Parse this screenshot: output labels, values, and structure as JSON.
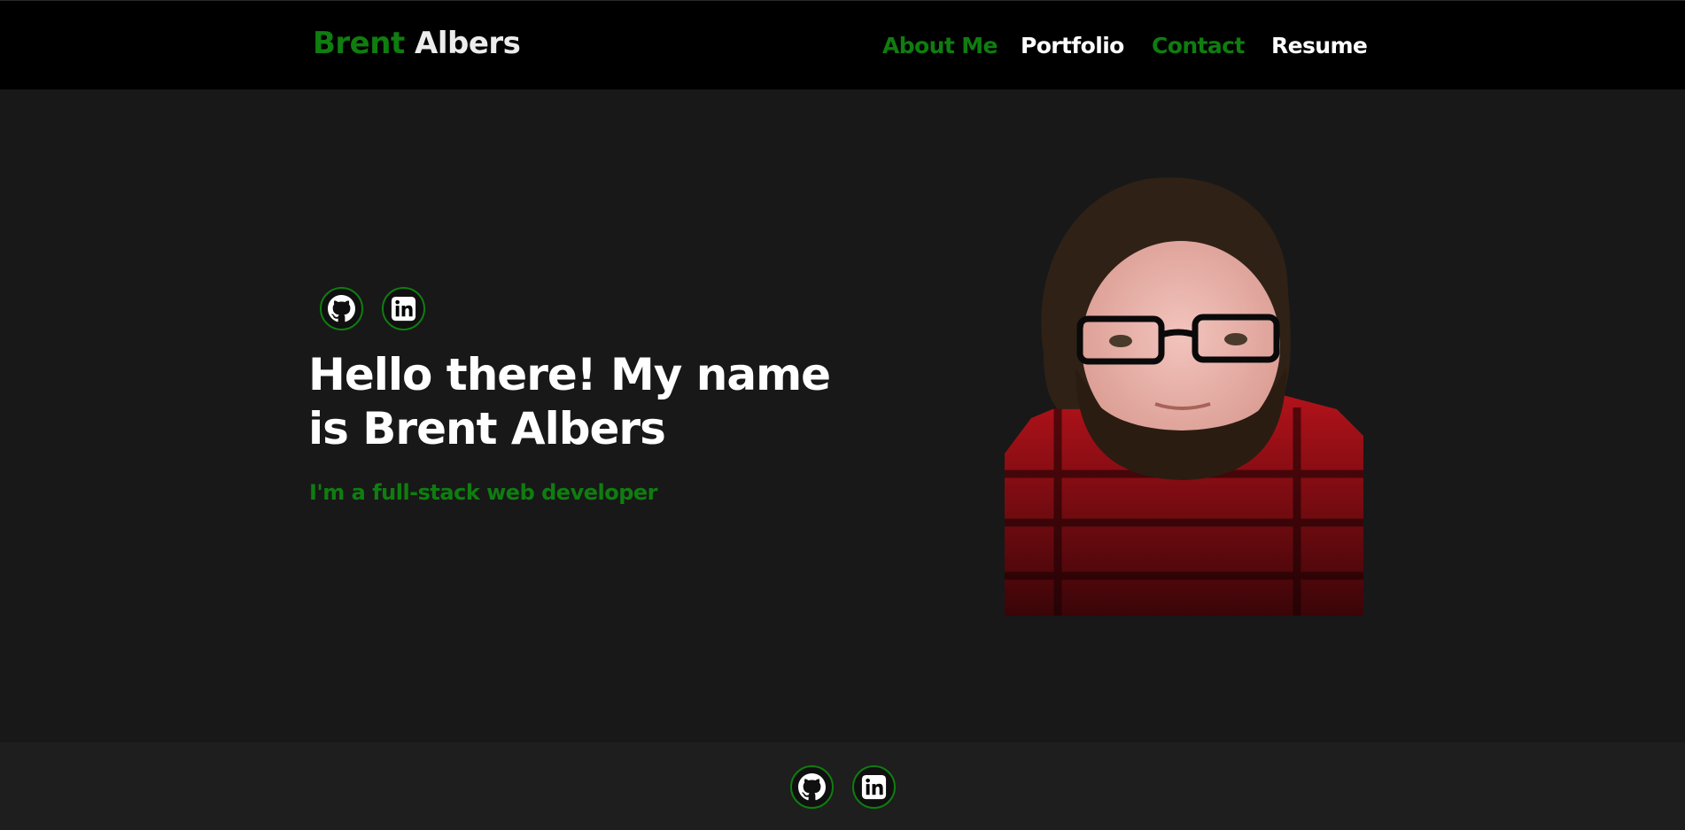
{
  "header": {
    "brand_first": "Brent",
    "brand_last": "Albers",
    "nav": {
      "about": "About Me",
      "portfolio": "Portfolio",
      "contact": "Contact",
      "resume": "Resume"
    }
  },
  "hero": {
    "title": "Hello there! My name is Brent Albers",
    "subtitle": "I'm a full-stack web developer",
    "social_icons": [
      "github-icon",
      "linkedin-icon"
    ]
  },
  "footer": {
    "social_icons": [
      "github-icon",
      "linkedin-icon"
    ]
  },
  "colors": {
    "accent": "#0f7d0f",
    "header_bg": "#000000",
    "page_bg": "#181818",
    "footer_bg": "#1e1e1e",
    "text": "#ffffff"
  }
}
